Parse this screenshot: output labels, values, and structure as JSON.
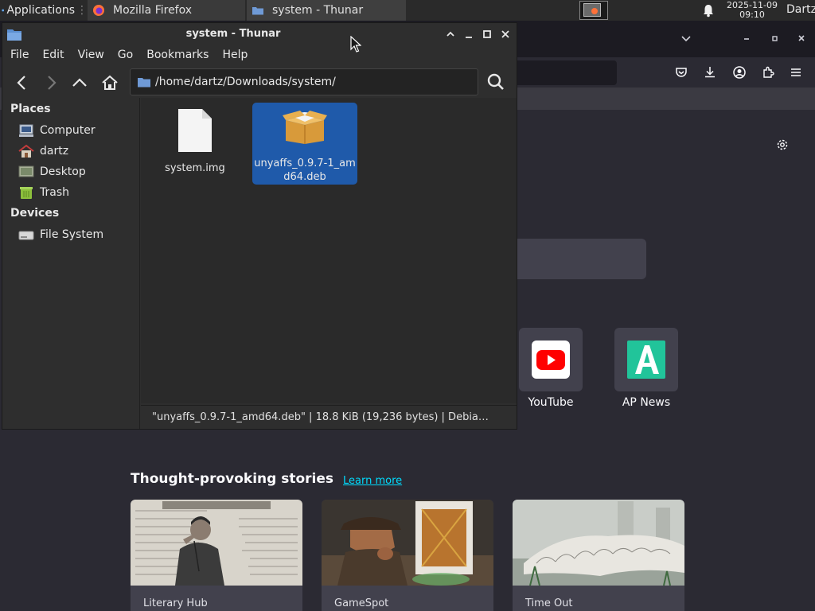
{
  "panel": {
    "applications": "Applications",
    "tasks": [
      {
        "label": "Mozilla Firefox"
      },
      {
        "label": "system - Thunar"
      }
    ],
    "clock_date": "2025-11-09",
    "clock_time": "09:10",
    "user": "Dartz"
  },
  "firefox": {
    "shortcuts": [
      {
        "label": "YouTube",
        "color": "#ff0000"
      },
      {
        "label": "AP News",
        "color": "#21c49a"
      }
    ],
    "stories_title": "Thought-provoking stories",
    "stories_link": "Learn more",
    "stories": [
      {
        "source": "Literary Hub"
      },
      {
        "source": "GameSpot"
      },
      {
        "source": "Time Out"
      }
    ]
  },
  "thunar": {
    "title": "system - Thunar",
    "menu": [
      "File",
      "Edit",
      "View",
      "Go",
      "Bookmarks",
      "Help"
    ],
    "location": "/home/dartz/Downloads/system/",
    "sidebar": {
      "places_header": "Places",
      "places": [
        {
          "label": "Computer",
          "icon": "computer-icon"
        },
        {
          "label": "dartz",
          "icon": "home-folder-icon"
        },
        {
          "label": "Desktop",
          "icon": "desktop-icon"
        },
        {
          "label": "Trash",
          "icon": "trash-icon"
        }
      ],
      "devices_header": "Devices",
      "devices": [
        {
          "label": "File System",
          "icon": "drive-icon"
        }
      ]
    },
    "files": [
      {
        "name": "system.img",
        "icon": "file-icon",
        "selected": false
      },
      {
        "name_line1": "unyaffs_0.9.7-1_am",
        "name_line2": "d64.deb",
        "icon": "package-icon",
        "selected": true
      }
    ],
    "status": "\"unyaffs_0.9.7-1_amd64.deb\"  |  18.8 KiB (19,236 bytes)  |  Debia…",
    "selection_color": "#1f5aaa"
  }
}
